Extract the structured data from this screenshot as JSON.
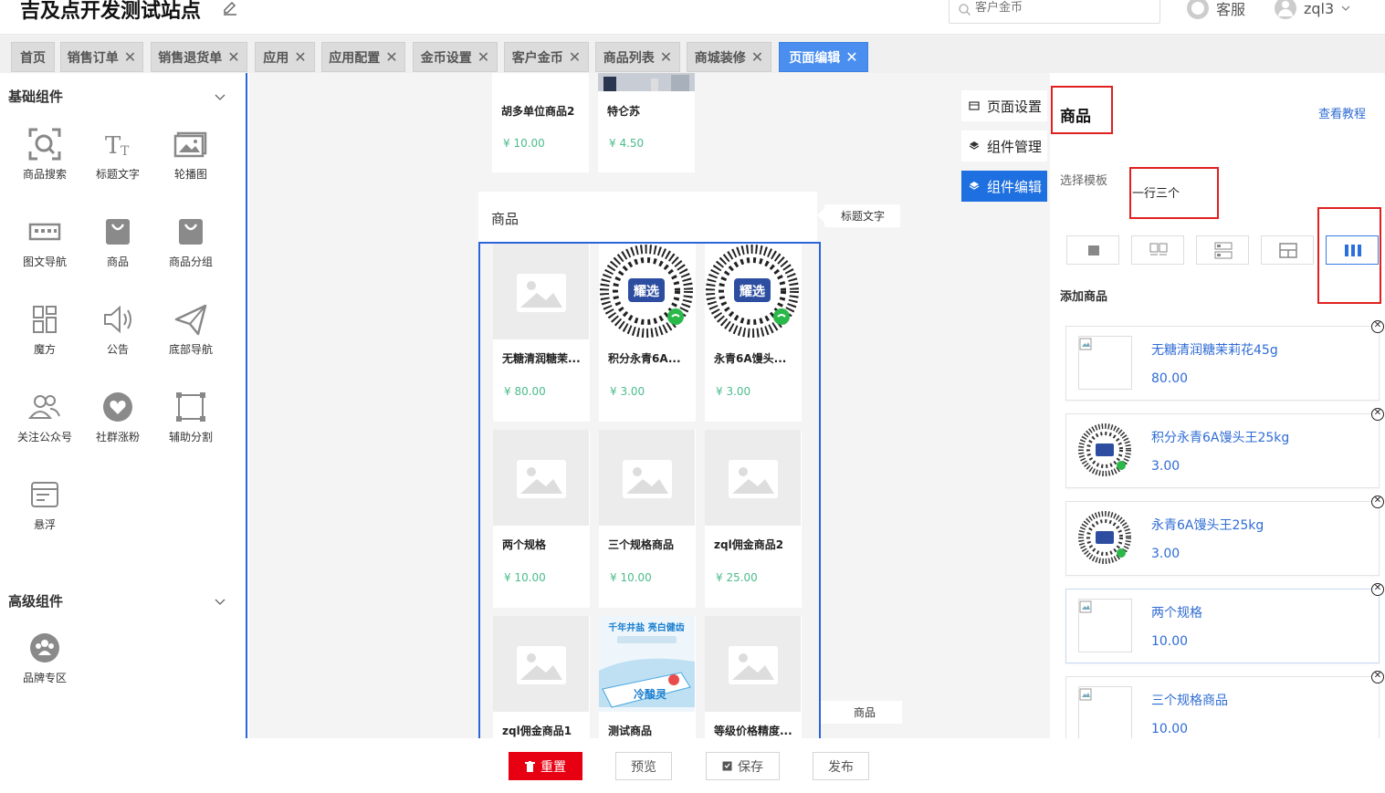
{
  "header": {
    "site_title": "吉及点开发测试站点",
    "search_placeholder": "客户金币",
    "kefu_label": "客服",
    "user_name": "zql3"
  },
  "tabs": [
    {
      "label": "首页",
      "closable": false
    },
    {
      "label": "销售订单",
      "closable": true
    },
    {
      "label": "销售退货单",
      "closable": true
    },
    {
      "label": "应用",
      "closable": true
    },
    {
      "label": "应用配置",
      "closable": true
    },
    {
      "label": "金币设置",
      "closable": true
    },
    {
      "label": "客户金币",
      "closable": true
    },
    {
      "label": "商品列表",
      "closable": true
    },
    {
      "label": "商城装修",
      "closable": true
    },
    {
      "label": "页面编辑",
      "closable": true,
      "active": true
    }
  ],
  "left_panel": {
    "basic_title": "基础组件",
    "basic_components": [
      {
        "label": "商品搜索",
        "icon": "product-search-icon"
      },
      {
        "label": "标题文字",
        "icon": "title-text-icon"
      },
      {
        "label": "轮播图",
        "icon": "carousel-icon"
      },
      {
        "label": "图文导航",
        "icon": "image-nav-icon"
      },
      {
        "label": "商品",
        "icon": "shopping-bag-icon"
      },
      {
        "label": "商品分组",
        "icon": "product-group-icon"
      },
      {
        "label": "魔方",
        "icon": "magic-cube-icon"
      },
      {
        "label": "公告",
        "icon": "announcement-icon"
      },
      {
        "label": "底部导航",
        "icon": "bottom-nav-icon"
      },
      {
        "label": "关注公众号",
        "icon": "follow-account-icon"
      },
      {
        "label": "社群涨粉",
        "icon": "community-icon"
      },
      {
        "label": "辅助分割",
        "icon": "divider-icon"
      },
      {
        "label": "悬浮",
        "icon": "float-icon"
      }
    ],
    "advanced_title": "高级组件",
    "advanced_components": [
      {
        "label": "品牌专区",
        "icon": "brand-zone-icon"
      }
    ]
  },
  "canvas": {
    "top_products": [
      {
        "name": "胡多单位商品2",
        "price": "¥ 10.00"
      },
      {
        "name": "特仑苏",
        "price": "¥ 4.50"
      }
    ],
    "section_title": "商品",
    "title_tag": "标题文字",
    "goods_tag": "商品",
    "products": [
      {
        "name": "无糖清润糖茉...",
        "price": "¥ 80.00",
        "image": "placeholder"
      },
      {
        "name": "积分永青6A...",
        "price": "¥ 3.00",
        "image": "qr"
      },
      {
        "name": "永青6A馒头...",
        "price": "¥ 3.00",
        "image": "qr"
      },
      {
        "name": "两个规格",
        "price": "¥ 10.00",
        "image": "placeholder"
      },
      {
        "name": "三个规格商品",
        "price": "¥ 10.00",
        "image": "placeholder"
      },
      {
        "name": "zql佣金商品2",
        "price": "¥ 25.00",
        "image": "placeholder"
      },
      {
        "name": "zql佣金商品1",
        "price": "",
        "image": "placeholder"
      },
      {
        "name": "测试商品",
        "price": "",
        "image": "toothpaste"
      },
      {
        "name": "等级价格精度...",
        "price": "",
        "image": "placeholder"
      }
    ],
    "qr_badge": "耀选",
    "toothpaste_text": "千年井盐 亮白健齿",
    "toothpaste_brand": "冷酸灵",
    "side_buttons": [
      {
        "label": "页面设置",
        "active": false
      },
      {
        "label": "组件管理",
        "active": false
      },
      {
        "label": "组件编辑",
        "active": true
      }
    ]
  },
  "right_panel": {
    "title": "商品",
    "tutorial_link": "查看教程",
    "template_label": "选择模板",
    "template_value": "一行三个",
    "add_goods_label": "添加商品",
    "goods": [
      {
        "name": "无糖清润糖茉莉花45g",
        "price": "80.00",
        "thumb": "broken"
      },
      {
        "name": "积分永青6A馒头王25kg",
        "price": "3.00",
        "thumb": "qr"
      },
      {
        "name": "永青6A馒头王25kg",
        "price": "3.00",
        "thumb": "qr"
      },
      {
        "name": "两个规格",
        "price": "10.00",
        "thumb": "broken"
      },
      {
        "name": "三个规格商品",
        "price": "10.00",
        "thumb": "broken"
      }
    ]
  },
  "bottom_bar": {
    "reset": "重置",
    "preview": "预览",
    "save": "保存",
    "publish": "发布"
  },
  "colors": {
    "primary": "#1e6fe0",
    "tab_active": "#4a8ff0",
    "price_green": "#4cbc8c",
    "link_blue": "#2f6cd4",
    "danger": "#e60012",
    "highlight_red": "#e02020"
  }
}
